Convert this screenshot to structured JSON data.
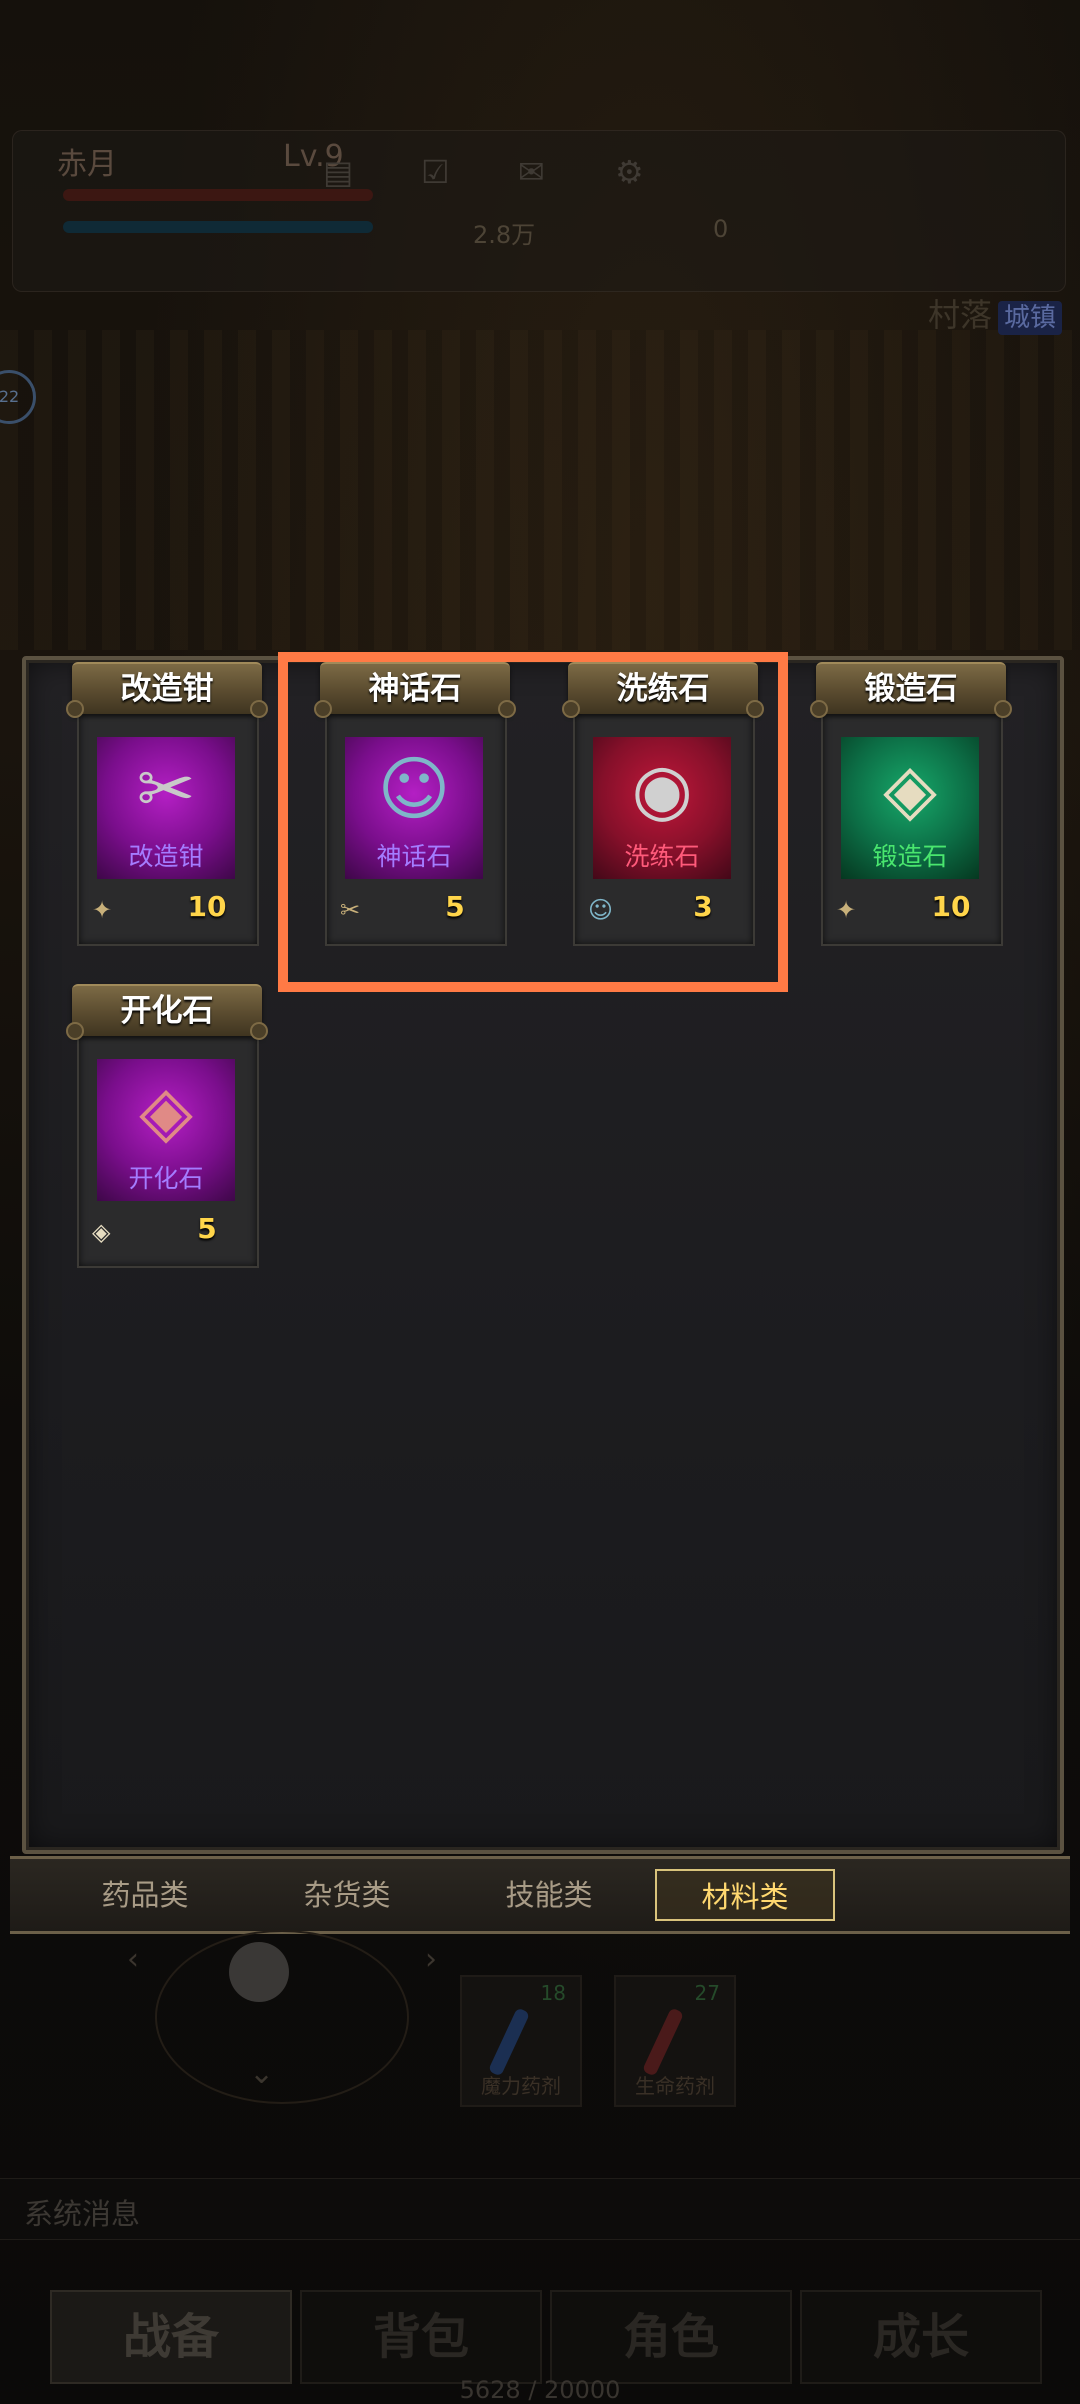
{
  "hud": {
    "player_name": "赤月",
    "level": "Lv.9",
    "gold": "2.8万",
    "gems": "0",
    "location": "村落",
    "location_type": "城镇",
    "badge": "22"
  },
  "inventory": {
    "items": [
      {
        "title": "改造钳",
        "art_label": "改造钳",
        "count": "10",
        "rarity": "purple",
        "icon": "pliers-icon"
      },
      {
        "title": "神话石",
        "art_label": "神话石",
        "count": "5",
        "rarity": "purple",
        "icon": "mythic-stone-icon"
      },
      {
        "title": "洗练石",
        "art_label": "洗练石",
        "count": "3",
        "rarity": "red",
        "icon": "refining-stone-icon"
      },
      {
        "title": "锻造石",
        "art_label": "锻造石",
        "count": "10",
        "rarity": "green",
        "icon": "forging-stone-icon"
      },
      {
        "title": "开化石",
        "art_label": "开化石",
        "count": "5",
        "rarity": "purple",
        "icon": "enlightening-stone-icon"
      }
    ]
  },
  "tabs": [
    {
      "label": "药品类",
      "active": false
    },
    {
      "label": "杂货类",
      "active": false
    },
    {
      "label": "技能类",
      "active": false
    },
    {
      "label": "材料类",
      "active": true
    }
  ],
  "potions": [
    {
      "count": "18",
      "label": "魔力药剂"
    },
    {
      "count": "27",
      "label": "生命药剂"
    }
  ],
  "system": {
    "label": "系统消息"
  },
  "nav": [
    "战备",
    "背包",
    "角色",
    "成长"
  ],
  "exp": "5628 / 20000",
  "colors": {
    "highlight": "#ff7a45",
    "count": "#ffd54a",
    "active_tab": "#ffd870"
  }
}
